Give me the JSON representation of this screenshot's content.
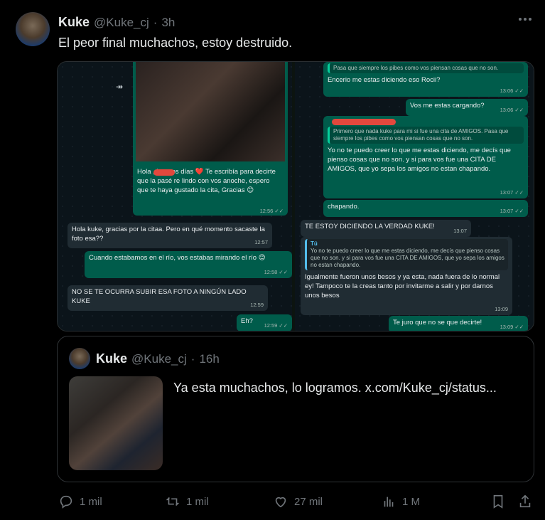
{
  "tweet": {
    "display_name": "Kuke",
    "handle": "@Kuke_cj",
    "separator": "·",
    "time": "3h",
    "more_icon": "ellipsis-icon",
    "text": "El peor final muchachos, estoy destruido."
  },
  "left_screenshot": {
    "main_message": "Hola       , buenos días ❤️ Te escribía para decirte que la pasé re lindo con vos anoche, espero que te haya gustado la cita, Gracias 😊",
    "main_time": "12:56 ✓✓",
    "messages": [
      {
        "text": "Hola kuke, gracias por la citaa. Pero en qué momento sacaste la foto esa??",
        "time": "12:57"
      },
      {
        "text": "Cuando estabamos en el río, vos estabas mirando el río 😊",
        "time": "12:58 ✓✓"
      },
      {
        "text": "NO SE TE OCURRA SUBIR ESA FOTO A NINGÚN LADO KUKE",
        "time": "12:59"
      },
      {
        "text": "Eh?",
        "time": "12:59 ✓✓"
      }
    ]
  },
  "right_screenshot": {
    "m1_quote": "Pasa que siempre los pibes como vos piensan cosas que no son.",
    "m1_text": "Encerio me estas diciendo eso Rocii?",
    "m1_time": "13:06 ✓✓",
    "m2_text": "Vos me estas cargando?",
    "m2_time": "13:06 ✓✓",
    "m3_quote": "Primero que nada kuke para mi si fue una cita de AMIGOS. Pasa que siempre los pibes como vos piensan cosas que no son.",
    "m3_text": "Yo no te puedo creer lo que me estas diciendo, me decís que pienso cosas que no son. y si para vos fue una CITA DE AMIGOS, que yo sepa los amigos no estan chapando.",
    "m3_time": "13:07 ✓✓",
    "m4_text": "chapando.",
    "m4_time": "13:07 ✓✓",
    "m5_text": "TE ESTOY DICIENDO LA VERDAD KUKE!",
    "m5_time": "13:07",
    "m6_quote_author": "Tú",
    "m6_quote": "Yo no te puedo creer lo que me estas diciendo, me decís que pienso cosas que no son. y si para vos fue una CITA DE AMIGOS, que yo sepa los amigos no estan chapando.",
    "m6_text": "Igualmente fueron unos besos y ya esta, nada fuera de lo normal ey! Tampoco te la creas tanto por invitarme a salir y por darnos unos besos",
    "m6_time": "13:09",
    "m7_text": "Te juro que no se que decirte!",
    "m7_time": "13:09 ✓✓"
  },
  "quoted_tweet": {
    "display_name": "Kuke",
    "handle": "@Kuke_cj",
    "separator": "·",
    "time": "16h",
    "text": "Ya esta muchachos, lo logramos.  x.com/Kuke_cj/status..."
  },
  "actions": {
    "replies": "1 mil",
    "reposts": "1 mil",
    "likes": "27 mil",
    "views": "1 M",
    "icons": [
      "reply-icon",
      "repost-icon",
      "like-icon",
      "views-icon",
      "bookmark-icon",
      "share-icon"
    ]
  },
  "colors": {
    "background": "#000000",
    "text": "#e7e9ea",
    "muted": "#71767b",
    "whatsapp_out": "#005c4b",
    "whatsapp_in": "#202c33",
    "redaction": "#e2483d"
  }
}
